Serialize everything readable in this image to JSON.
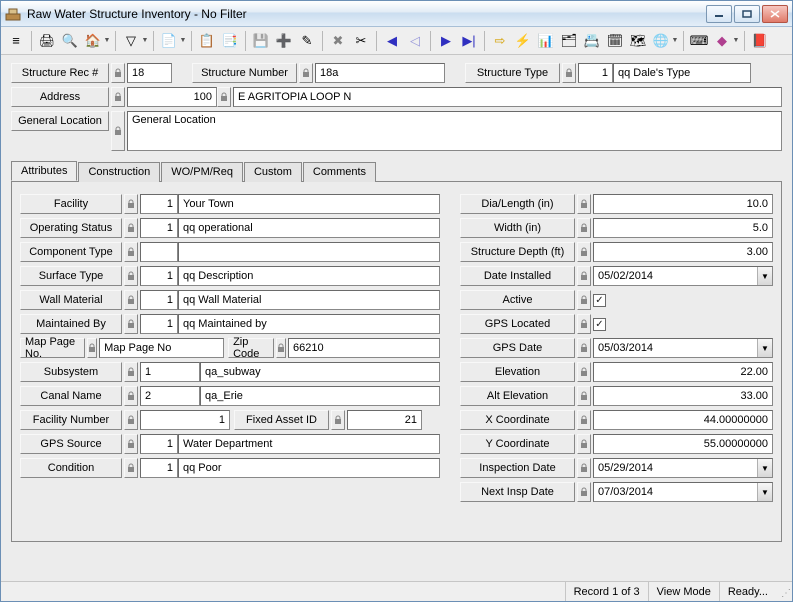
{
  "window": {
    "title": "Raw Water Structure Inventory - No Filter"
  },
  "header": {
    "structure_rec_label": "Structure Rec #",
    "structure_rec": "18",
    "structure_number_label": "Structure Number",
    "structure_number": "18a",
    "structure_type_label": "Structure Type",
    "structure_type_code": "1",
    "structure_type_name": "qq Dale's Type",
    "address_label": "Address",
    "address_num": "100",
    "address_street": "E AGRITOPIA LOOP N",
    "general_location_label": "General Location",
    "general_location": "General Location"
  },
  "tabs": {
    "items": [
      "Attributes",
      "Construction",
      "WO/PM/Req",
      "Custom",
      "Comments"
    ],
    "active": 0
  },
  "attr": {
    "facility_label": "Facility",
    "facility_code": "1",
    "facility_name": "Your Town",
    "op_status_label": "Operating Status",
    "op_status_code": "1",
    "op_status_name": "qq operational",
    "comp_type_label": "Component Type",
    "comp_type_code": "",
    "comp_type_name": "",
    "surface_type_label": "Surface Type",
    "surface_type_code": "1",
    "surface_type_name": "qq Description",
    "wall_mat_label": "Wall Material",
    "wall_mat_code": "1",
    "wall_mat_name": "qq Wall Material",
    "maint_by_label": "Maintained By",
    "maint_by_code": "1",
    "maint_by_name": "qq Maintained by",
    "map_page_label": "Map Page No.",
    "map_page": "Map Page No",
    "zip_label": "Zip Code",
    "zip": "66210",
    "subsystem_label": "Subsystem",
    "subsystem_code": "1",
    "subsystem_name": "qa_subway",
    "canal_label": "Canal Name",
    "canal_code": "2",
    "canal_name": "qa_Erie",
    "facility_num_label": "Facility Number",
    "facility_num": "1",
    "fixed_asset_label": "Fixed Asset ID",
    "fixed_asset": "21",
    "gps_src_label": "GPS Source",
    "gps_src_code": "1",
    "gps_src_name": "Water Department",
    "condition_label": "Condition",
    "condition_code": "1",
    "condition_name": "qq Poor",
    "dia_len_label": "Dia/Length (in)",
    "dia_len": "10.0",
    "width_label": "Width (in)",
    "width": "5.0",
    "depth_label": "Structure Depth (ft)",
    "depth": "3.00",
    "date_installed_label": "Date Installed",
    "date_installed": "05/02/2014",
    "active_label": "Active",
    "active_checked": true,
    "gps_located_label": "GPS Located",
    "gps_located_checked": true,
    "gps_date_label": "GPS Date",
    "gps_date": "05/03/2014",
    "elevation_label": "Elevation",
    "elevation": "22.00",
    "alt_elev_label": "Alt Elevation",
    "alt_elev": "33.00",
    "x_coord_label": "X Coordinate",
    "x_coord": "44.00000000",
    "y_coord_label": "Y Coordinate",
    "y_coord": "55.00000000",
    "insp_date_label": "Inspection Date",
    "insp_date": "05/29/2014",
    "next_insp_label": "Next Insp Date",
    "next_insp": "07/03/2014"
  },
  "status": {
    "record": "Record 1 of 3",
    "mode": "View Mode",
    "ready": "Ready..."
  }
}
